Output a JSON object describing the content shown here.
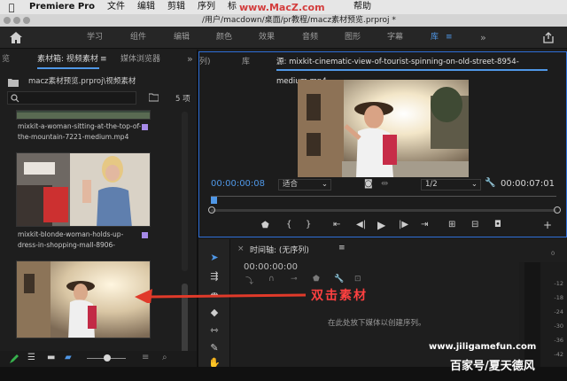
{
  "menubar": {
    "app": "Premiere Pro",
    "items": [
      "文件",
      "编辑",
      "剪辑",
      "序列",
      "标",
      "...",
      ""
    ],
    "help": "帮助",
    "watermark": "www.MacZ.com"
  },
  "window": {
    "title": "/用户/macdown/桌面/pr教程/macz素材预览.prproj *"
  },
  "workspaces": {
    "items": [
      {
        "label": "学习"
      },
      {
        "label": "组件"
      },
      {
        "label": "编辑"
      },
      {
        "label": "颜色"
      },
      {
        "label": "效果"
      },
      {
        "label": "音频"
      },
      {
        "label": "图形"
      },
      {
        "label": "字幕"
      },
      {
        "label": "库"
      }
    ],
    "more": "»"
  },
  "project": {
    "tab_prev": "览",
    "tab_active": "素材箱: 视频素材",
    "tab_menu": "≡",
    "tab_next": "媒体浏览器",
    "tab_more": "»",
    "path": "macz素材预览.prproj\\视频素材",
    "search_placeholder": "",
    "count": "5 项",
    "clips": [
      {
        "name1": "mixkit-a-woman-sitting-at-the-top-of-",
        "name2": "the-mountain-7221-medium.mp4"
      },
      {
        "name1": "mixkit-blonde-woman-holds-up-",
        "name2": "dress-in-shopping-mall-8906-"
      },
      {
        "name1": "",
        "name2": ""
      }
    ]
  },
  "source": {
    "tab_prev": "列)",
    "tab_lib": "库",
    "title": "源: mixkit-cinematic-view-of-tourist-spinning-on-old-street-8954-medium.mp4",
    "timecode": "00:00:00:08",
    "fit": "适合",
    "ratio": "1/2",
    "duration": "00:00:07:01"
  },
  "timeline": {
    "tab": "时间轴: (无序列)",
    "menu": "≡",
    "timecode": "00:00:00:00",
    "empty_msg": "在此处放下媒体以创建序列。",
    "meter_ticks": [
      "0",
      "-12",
      "-18",
      "-24",
      "-30",
      "-36",
      "-42",
      "-48"
    ]
  },
  "annotation": {
    "label": "双击素材",
    "color": "#e03a2a"
  },
  "overlay": {
    "url": "www.jiligamefun.com",
    "baidu": "百家号/夏天德风"
  },
  "colors": {
    "accent": "#4f97e6",
    "label_purple": "#a68ae8"
  }
}
